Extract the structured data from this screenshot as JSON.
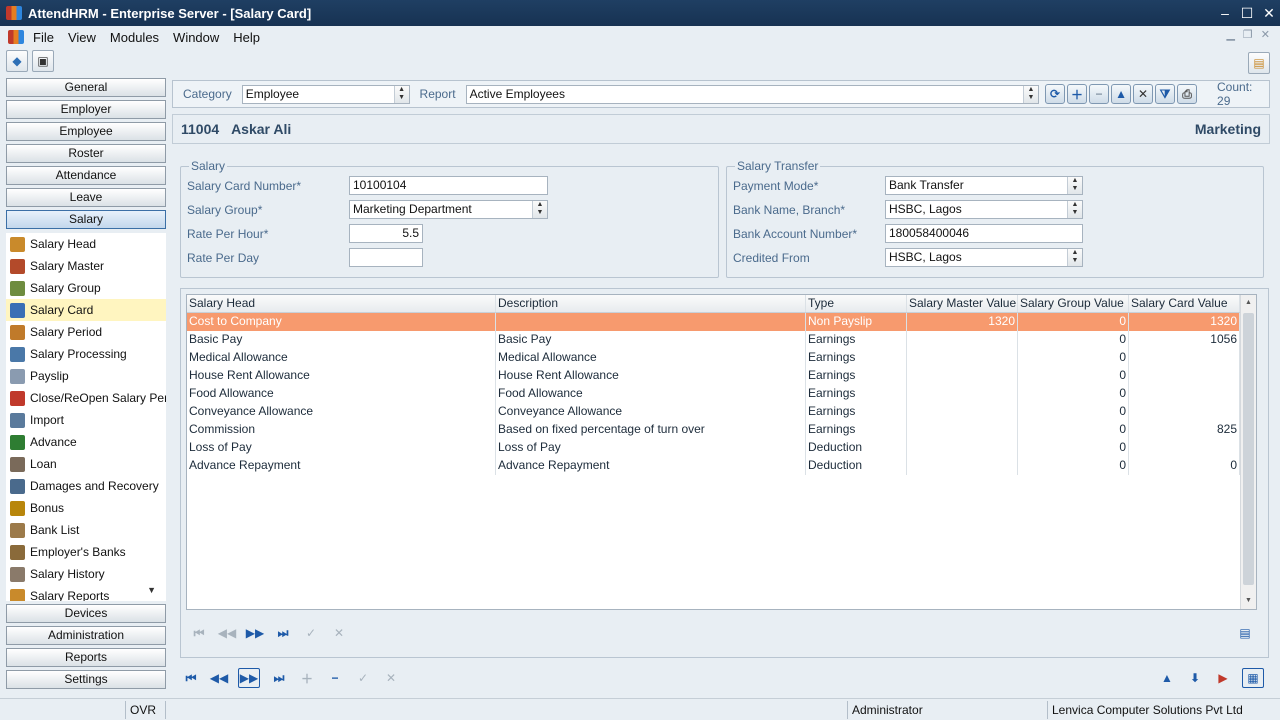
{
  "window": {
    "title": "AttendHRM - Enterprise Server - [Salary Card]"
  },
  "menu": [
    "File",
    "View",
    "Modules",
    "Window",
    "Help"
  ],
  "sidebar": {
    "top_buttons": [
      "General",
      "Employer",
      "Employee",
      "Roster",
      "Attendance",
      "Leave",
      "Salary"
    ],
    "items": [
      {
        "label": "Salary Head",
        "icon": "salary-head-icon",
        "color": "#c98a2b"
      },
      {
        "label": "Salary Master",
        "icon": "salary-master-icon",
        "color": "#b34a2a"
      },
      {
        "label": "Salary Group",
        "icon": "salary-group-icon",
        "color": "#6e8c3f"
      },
      {
        "label": "Salary Card",
        "icon": "salary-card-icon",
        "color": "#3a6fb5"
      },
      {
        "label": "Salary Period",
        "icon": "salary-period-icon",
        "color": "#c07a2a"
      },
      {
        "label": "Salary Processing",
        "icon": "salary-processing-icon",
        "color": "#4a78a8"
      },
      {
        "label": "Payslip",
        "icon": "payslip-icon",
        "color": "#8a9bb0"
      },
      {
        "label": "Close/ReOpen Salary Per...",
        "icon": "close-reopen-icon",
        "color": "#c0392b"
      },
      {
        "label": "Import",
        "icon": "import-icon",
        "color": "#5a7a9c"
      },
      {
        "label": "Advance",
        "icon": "advance-icon",
        "color": "#2e7d32"
      },
      {
        "label": "Loan",
        "icon": "loan-icon",
        "color": "#7a6a5a"
      },
      {
        "label": "Damages and Recovery",
        "icon": "damages-icon",
        "color": "#4a6a8c"
      },
      {
        "label": "Bonus",
        "icon": "bonus-icon",
        "color": "#b8860b"
      },
      {
        "label": "Bank List",
        "icon": "bank-list-icon",
        "color": "#9c7a4a"
      },
      {
        "label": "Employer's Banks",
        "icon": "employers-banks-icon",
        "color": "#8a6a3a"
      },
      {
        "label": "Salary History",
        "icon": "salary-history-icon",
        "color": "#8a7a6a"
      },
      {
        "label": "Salary Reports",
        "icon": "salary-reports-icon",
        "color": "#c98a2b"
      }
    ],
    "bottom_buttons": [
      "Devices",
      "Administration",
      "Reports",
      "Settings"
    ]
  },
  "filter": {
    "category_label": "Category",
    "category_value": "Employee",
    "report_label": "Report",
    "report_value": "Active Employees",
    "count": "Count: 29"
  },
  "employee": {
    "id": "11004",
    "name": "Askar Ali",
    "department": "Marketing"
  },
  "salary": {
    "legend": "Salary",
    "card_number_label": "Salary Card Number*",
    "card_number": "10100104",
    "group_label": "Salary Group*",
    "group": "Marketing Department",
    "rate_hour_label": "Rate Per Hour*",
    "rate_hour": "5.5",
    "rate_day_label": "Rate Per Day",
    "rate_day": ""
  },
  "transfer": {
    "legend": "Salary Transfer",
    "payment_mode_label": "Payment Mode*",
    "payment_mode": "Bank Transfer",
    "bank_label": "Bank Name, Branch*",
    "bank": "HSBC, Lagos",
    "account_label": "Bank Account Number*",
    "account": "180058400046",
    "credited_label": "Credited From",
    "credited": "HSBC, Lagos"
  },
  "grid": {
    "columns": [
      "Salary Head",
      "Description",
      "Type",
      "Salary Master Value",
      "Salary Group Value",
      "Salary Card Value"
    ],
    "rows": [
      [
        "Cost to Company",
        "",
        "Non Payslip",
        "1320",
        "0",
        "1320"
      ],
      [
        "Basic Pay",
        "Basic Pay",
        "Earnings",
        "",
        "0",
        "1056"
      ],
      [
        "Medical Allowance",
        "Medical Allowance",
        "Earnings",
        "",
        "0",
        ""
      ],
      [
        "House Rent Allowance",
        "House Rent Allowance",
        "Earnings",
        "",
        "0",
        ""
      ],
      [
        "Food Allowance",
        "Food Allowance",
        "Earnings",
        "",
        "0",
        ""
      ],
      [
        "Conveyance Allowance",
        "Conveyance Allowance",
        "Earnings",
        "",
        "0",
        ""
      ],
      [
        "Commission",
        "Based on fixed percentage of turn over",
        "Earnings",
        "",
        "0",
        "825"
      ],
      [
        "Loss of Pay",
        "Loss of Pay",
        "Deduction",
        "",
        "0",
        ""
      ],
      [
        "Advance Repayment",
        "Advance Repayment",
        "Deduction",
        "",
        "0",
        "0"
      ]
    ]
  },
  "status": {
    "mode": "OVR",
    "user": "Administrator",
    "company": "Lenvica Computer Solutions Pvt Ltd"
  },
  "colors": {
    "selected_row": "#f79a6e",
    "titlebar": "#1f3f63",
    "accent": "#1e5aa8"
  }
}
